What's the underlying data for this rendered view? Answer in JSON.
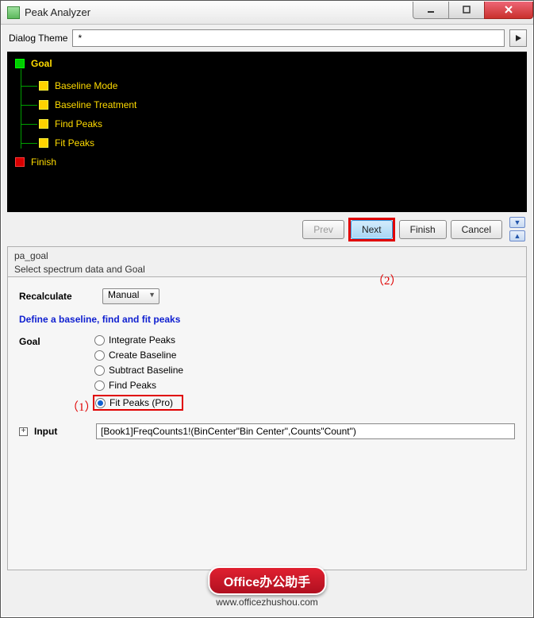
{
  "window": {
    "title": "Peak Analyzer"
  },
  "theme": {
    "label": "Dialog Theme",
    "value": "*"
  },
  "tree": {
    "root": "Goal",
    "items": [
      "Baseline Mode",
      "Baseline Treatment",
      "Find Peaks",
      "Fit Peaks"
    ],
    "finish": "Finish"
  },
  "nav": {
    "prev": "Prev",
    "next": "Next",
    "finish": "Finish",
    "cancel": "Cancel"
  },
  "section": {
    "code": "pa_goal",
    "desc": "Select spectrum data and Goal"
  },
  "recalc": {
    "label": "Recalculate",
    "value": "Manual"
  },
  "subtitle": "Define a baseline, find and fit peaks",
  "goal": {
    "label": "Goal",
    "options": [
      "Integrate Peaks",
      "Create Baseline",
      "Subtract Baseline",
      "Find Peaks",
      "Fit Peaks (Pro)"
    ],
    "selected_index": 4
  },
  "input": {
    "label": "Input",
    "value": "[Book1]FreqCounts1!(BinCenter\"Bin Center\",Counts\"Count\")"
  },
  "annotations": {
    "a1": "（1）",
    "a2": "（2）"
  },
  "watermark": {
    "pill": "Office办公助手",
    "url": "www.officezhushou.com"
  }
}
